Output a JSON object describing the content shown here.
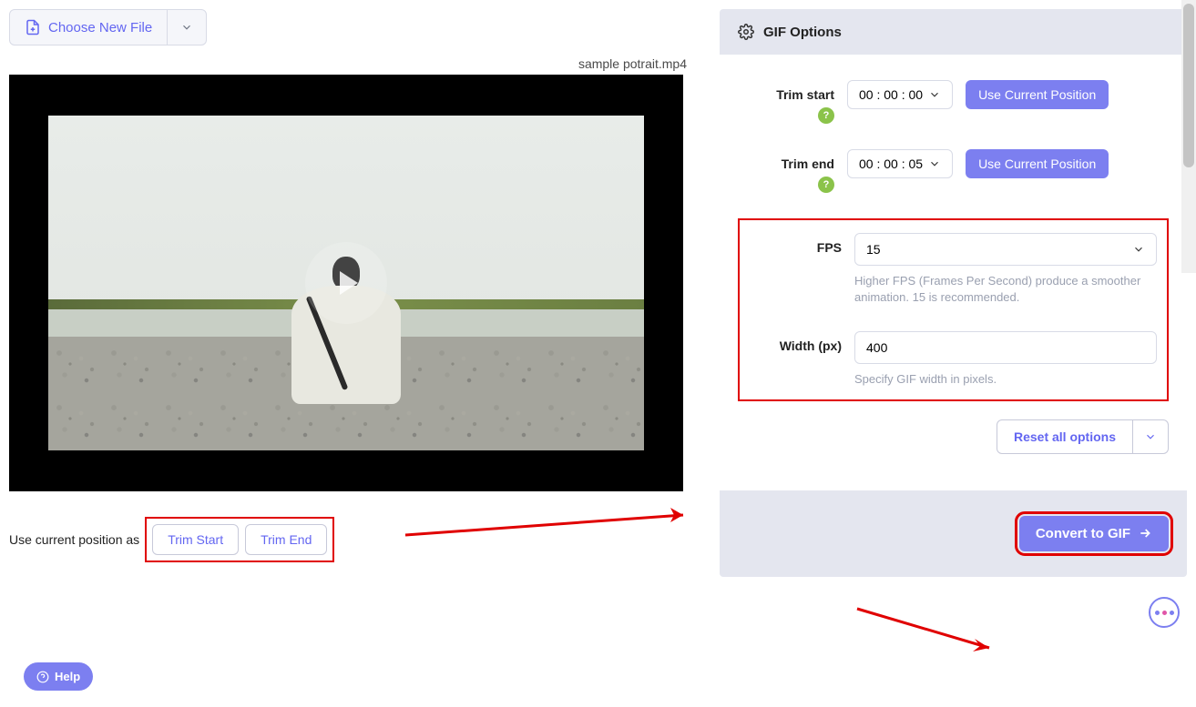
{
  "file_picker": {
    "choose_label": "Choose New File"
  },
  "filename": "sample potrait.mp4",
  "trim_position": {
    "label": "Use current position as",
    "start_btn": "Trim Start",
    "end_btn": "Trim End"
  },
  "options": {
    "title": "GIF Options",
    "trim_start": {
      "label": "Trim start",
      "value": "00 : 00 : 00",
      "btn": "Use Current Position"
    },
    "trim_end": {
      "label": "Trim end",
      "value": "00 : 00 : 05",
      "btn": "Use Current Position"
    },
    "fps": {
      "label": "FPS",
      "value": "15",
      "hint": "Higher FPS (Frames Per Second) produce a smoother animation. 15 is recommended."
    },
    "width": {
      "label": "Width (px)",
      "value": "400",
      "hint": "Specify GIF width in pixels."
    },
    "reset": "Reset all options",
    "convert": "Convert to GIF"
  },
  "help_fab": "Help",
  "help_tooltip": "?"
}
